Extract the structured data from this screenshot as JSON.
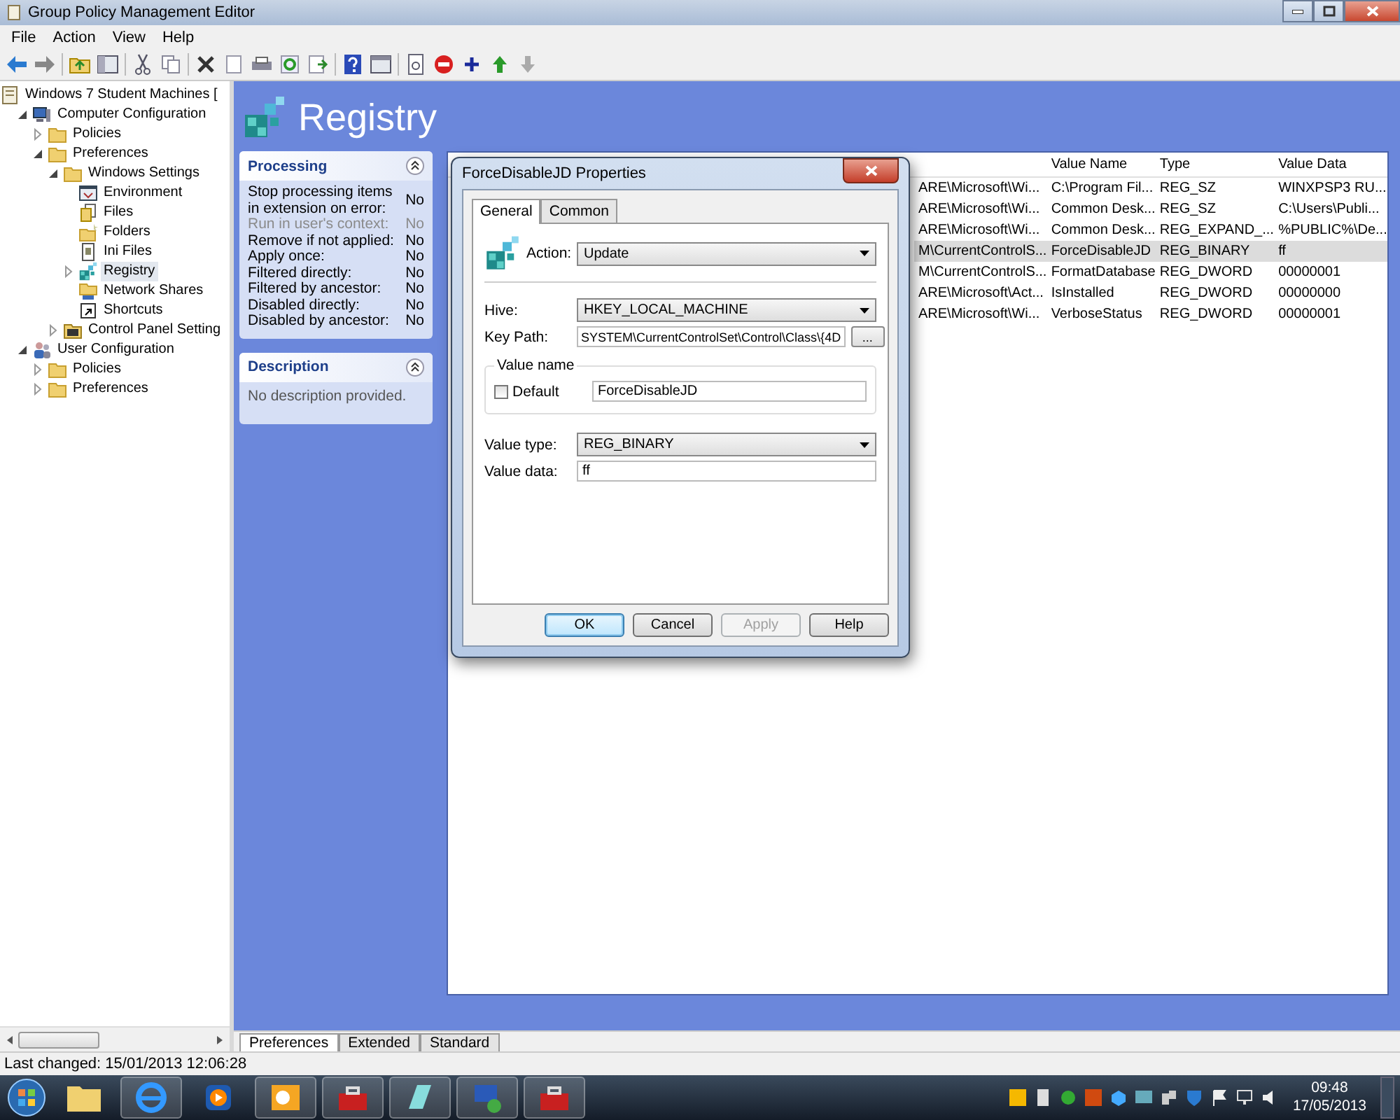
{
  "window": {
    "title": "Group Policy Management Editor"
  },
  "menu": [
    "File",
    "Action",
    "View",
    "Help"
  ],
  "tree": [
    {
      "label": "Windows 7 Student Machines [",
      "kind": "gpo",
      "selected": false,
      "children": [
        {
          "label": "Computer Configuration",
          "kind": "computer",
          "selected": false,
          "expanded": true,
          "children": [
            {
              "label": "Policies",
              "kind": "folder",
              "selected": false,
              "expanded": false
            },
            {
              "label": "Preferences",
              "kind": "folder",
              "selected": false,
              "expanded": true,
              "children": [
                {
                  "label": "Windows Settings",
                  "kind": "folder",
                  "selected": false,
                  "expanded": true,
                  "children": [
                    {
                      "label": "Environment",
                      "kind": "environment",
                      "selected": false
                    },
                    {
                      "label": "Files",
                      "kind": "files",
                      "selected": false
                    },
                    {
                      "label": "Folders",
                      "kind": "folders",
                      "selected": false
                    },
                    {
                      "label": "Ini Files",
                      "kind": "ini",
                      "selected": false
                    },
                    {
                      "label": "Registry",
                      "kind": "registry",
                      "selected": true,
                      "expanded": false
                    },
                    {
                      "label": "Network Shares",
                      "kind": "network",
                      "selected": false
                    },
                    {
                      "label": "Shortcuts",
                      "kind": "shortcut",
                      "selected": false
                    }
                  ]
                },
                {
                  "label": "Control Panel Setting",
                  "kind": "control",
                  "selected": false,
                  "expanded": false
                }
              ]
            }
          ]
        },
        {
          "label": "User Configuration",
          "kind": "user",
          "selected": false,
          "expanded": true,
          "children": [
            {
              "label": "Policies",
              "kind": "folder",
              "selected": false,
              "expanded": false
            },
            {
              "label": "Preferences",
              "kind": "folder",
              "selected": false,
              "expanded": false
            }
          ]
        }
      ]
    }
  ],
  "heading": "Registry",
  "processing": {
    "title": "Processing",
    "rows": [
      {
        "label": "Stop processing items in extension on error:",
        "value": "No",
        "disabled": false
      },
      {
        "label": "Run in user's context:",
        "value": "No",
        "disabled": true
      },
      {
        "label": "Remove if not applied:",
        "value": "No",
        "disabled": false
      },
      {
        "label": "Apply once:",
        "value": "No",
        "disabled": false
      },
      {
        "label": "Filtered directly:",
        "value": "No",
        "disabled": false
      },
      {
        "label": "Filtered by ancestor:",
        "value": "No",
        "disabled": false
      },
      {
        "label": "Disabled directly:",
        "value": "No",
        "disabled": false
      },
      {
        "label": "Disabled by ancestor:",
        "value": "No",
        "disabled": false
      }
    ]
  },
  "description": {
    "title": "Description",
    "text": "No description provided."
  },
  "list": {
    "columns": [
      "Value Name",
      "Type",
      "Value Data"
    ],
    "rows": [
      {
        "key_path": "ARE\\Microsoft\\Wi...",
        "value_name": "C:\\Program Fil...",
        "type": "REG_SZ",
        "value_data": "WINXPSP3 RU...",
        "selected": false
      },
      {
        "key_path": "ARE\\Microsoft\\Wi...",
        "value_name": "Common Desk...",
        "type": "REG_SZ",
        "value_data": "C:\\Users\\Publi...",
        "selected": false
      },
      {
        "key_path": "ARE\\Microsoft\\Wi...",
        "value_name": "Common Desk...",
        "type": "REG_EXPAND_...",
        "value_data": "%PUBLIC%\\De...",
        "selected": false
      },
      {
        "key_path": "M\\CurrentControlS...",
        "value_name": "ForceDisableJD",
        "type": "REG_BINARY",
        "value_data": "ff",
        "selected": true
      },
      {
        "key_path": "M\\CurrentControlS...",
        "value_name": "FormatDatabase",
        "type": "REG_DWORD",
        "value_data": "00000001",
        "selected": false
      },
      {
        "key_path": "ARE\\Microsoft\\Act...",
        "value_name": "IsInstalled",
        "type": "REG_DWORD",
        "value_data": "00000000",
        "selected": false
      },
      {
        "key_path": "ARE\\Microsoft\\Wi...",
        "value_name": "VerboseStatus",
        "type": "REG_DWORD",
        "value_data": "00000001",
        "selected": false
      }
    ]
  },
  "view_tabs": [
    {
      "label": "Preferences",
      "selected": true
    },
    {
      "label": "Extended",
      "selected": false
    },
    {
      "label": "Standard",
      "selected": false
    }
  ],
  "status_bar": "Last changed: 15/01/2013 12:06:28",
  "dialog": {
    "title": "ForceDisableJD Properties",
    "tabs": [
      {
        "label": "General",
        "selected": true
      },
      {
        "label": "Common",
        "selected": false
      }
    ],
    "action": {
      "label": "Action:",
      "value": "Update"
    },
    "hive": {
      "label": "Hive:",
      "value": "HKEY_LOCAL_MACHINE"
    },
    "key_path": {
      "label": "Key Path:",
      "value": "SYSTEM\\CurrentControlSet\\Control\\Class\\{4D",
      "browse": "..."
    },
    "value_name": {
      "title": "Value name",
      "default_label": "Default",
      "default_checked": false,
      "value": "ForceDisableJD"
    },
    "value_type": {
      "label": "Value type:",
      "value": "REG_BINARY"
    },
    "value_data": {
      "label": "Value data:",
      "value": "ff"
    },
    "buttons": [
      {
        "label": "OK",
        "default": true,
        "disabled": false
      },
      {
        "label": "Cancel",
        "default": false,
        "disabled": false
      },
      {
        "label": "Apply",
        "default": false,
        "disabled": true
      },
      {
        "label": "Help",
        "default": false,
        "disabled": false
      }
    ]
  },
  "taskbar": {
    "time": "09:48",
    "date": "17/05/2013"
  }
}
